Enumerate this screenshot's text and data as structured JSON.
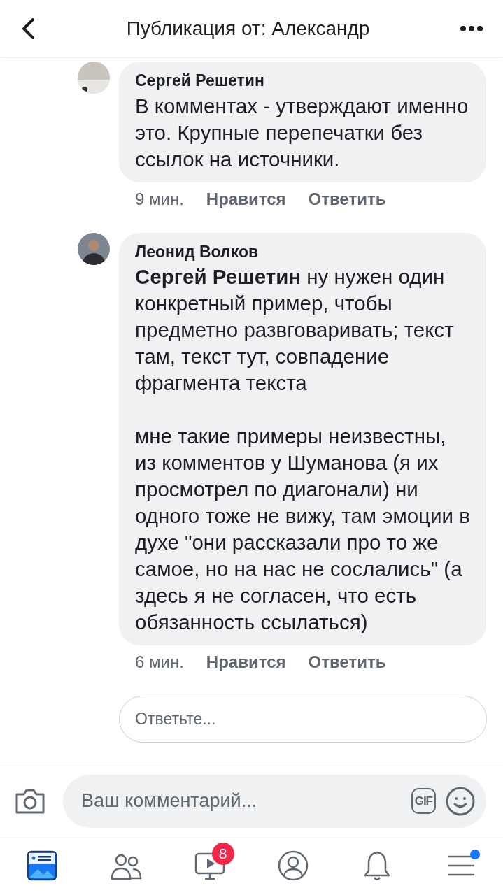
{
  "header": {
    "title": "Публикация от: Александр"
  },
  "comments": [
    {
      "author": "Сергей Решетин",
      "paragraphs": [
        "В комментах - утверждают именно это. Крупные перепечатки без ссылок на источники."
      ],
      "time": "9 мин.",
      "like": "Нравится",
      "reply": "Ответить"
    },
    {
      "author": "Леонид Волков",
      "paragraphs": [
        "**Сергей Решетин** ну нужен один конкретный пример, чтобы предметно развговаривать; текст там, текст тут, совпадение фрагмента текста",
        "мне такие примеры неизвестны, из комментов у Шуманова (я их просмотрел по диагонали) ни одного тоже не вижу, там эмоции в духе \"они рассказали про то же самое, но на нас не сослались\" (а здесь я не согласен, что есть обязанность ссылаться)"
      ],
      "time": "6 мин.",
      "like": "Нравится",
      "reply": "Ответить"
    }
  ],
  "reply_field": {
    "placeholder": "Ответьте..."
  },
  "composer": {
    "placeholder": "Ваш комментарий...",
    "gif": "GIF"
  },
  "tabs": [
    {
      "kind": "feed",
      "selected": true
    },
    {
      "kind": "friends",
      "selected": false
    },
    {
      "kind": "watch",
      "selected": false,
      "badge": "8"
    },
    {
      "kind": "profile",
      "selected": false
    },
    {
      "kind": "notifications",
      "selected": false
    },
    {
      "kind": "menu",
      "selected": false,
      "dot": true
    }
  ]
}
